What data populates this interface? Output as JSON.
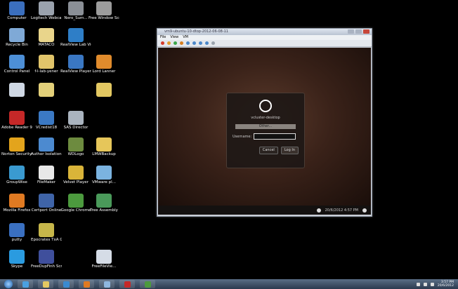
{
  "desktop": {
    "icons": [
      {
        "label": "Computer",
        "color": "#3b6fbe"
      },
      {
        "label": "Logitech Webcam",
        "color": "#9aa2ad"
      },
      {
        "label": "Nero_Sum...",
        "color": "#8a8f96"
      },
      {
        "label": "Free Window Screensaver",
        "color": "#9c9c9c"
      },
      {
        "label": "Recycle Bin",
        "color": "#7fa9d6"
      },
      {
        "label": "MATACO",
        "color": "#e9d58b"
      },
      {
        "label": "RealView Lab Vie...",
        "color": "#2e7ec7"
      },
      {
        "label": "Control Panel",
        "color": "#4d8fd6"
      },
      {
        "label": "f-l-lab-yener",
        "color": "#e1c46a"
      },
      {
        "label": "RealView Player",
        "color": "#3a77c2"
      },
      {
        "label": "Lord Lanner",
        "color": "#e08b2c"
      },
      {
        "label": "",
        "color": "#cfd8e4"
      },
      {
        "label": "",
        "color": "#e3d07a"
      },
      {
        "label": "",
        "color": "#e3c862"
      },
      {
        "label": "Adobe Reader 9",
        "color": "#c52828"
      },
      {
        "label": "VCredist18",
        "color": "#3b79c4"
      },
      {
        "label": "SAS Director",
        "color": "#aab4bf"
      },
      {
        "label": "Norton Security Scan",
        "color": "#e3a41c"
      },
      {
        "label": "Author Isolation...",
        "color": "#4c8ad0"
      },
      {
        "label": "WDLogo",
        "color": "#6d8b3f"
      },
      {
        "label": "LMWBackup",
        "color": "#e6c65a"
      },
      {
        "label": "GroupWise",
        "color": "#3a9ad0"
      },
      {
        "label": "FileMaker",
        "color": "#e8e8e8"
      },
      {
        "label": "Velvet Player",
        "color": "#d9b439"
      },
      {
        "label": "VMware pl...",
        "color": "#7bb3e0"
      },
      {
        "label": "Mozilla Firefox",
        "color": "#e07a22"
      },
      {
        "label": "Certport Online",
        "color": "#3f64a8"
      },
      {
        "label": "Google Chrome",
        "color": "#4c9a3e"
      },
      {
        "label": "Tree Assembly",
        "color": "#4a9a5a"
      },
      {
        "label": "putty",
        "color": "#3a70c1"
      },
      {
        "label": "Epocrates TxA Go...",
        "color": "#c6b64a"
      },
      {
        "label": "Skype",
        "color": "#2a9be0"
      },
      {
        "label": "FreeDupFinh Screenrecorder",
        "color": "#3f4f9c"
      },
      {
        "label": "FreeFileVie...",
        "color": "#d5dce6"
      }
    ]
  },
  "vm_window": {
    "title": "vm9-ubuntu-10-dtop-2012-06-08-11",
    "menu": [
      "File",
      "View",
      "VM"
    ],
    "toolbar_icons": [
      {
        "name": "stop-icon",
        "color": "#d53a2a"
      },
      {
        "name": "pause-icon",
        "color": "#e39a2b"
      },
      {
        "name": "play-icon",
        "color": "#3aa64a"
      },
      {
        "name": "reset-icon",
        "color": "#d67e1f"
      },
      {
        "name": "snapshot-icon",
        "color": "#4a86c8"
      },
      {
        "name": "revert-icon",
        "color": "#4a86c8"
      },
      {
        "name": "manager-icon",
        "color": "#4a86c8"
      },
      {
        "name": "fullscreen-icon",
        "color": "#4a86c8"
      },
      {
        "name": "unity-icon",
        "color": "#9aa2ad"
      }
    ],
    "login": {
      "hostname": "vcluster-desktop",
      "other_label": "Other...",
      "username_label": "Username:",
      "username_value": "",
      "cancel_label": "Cancel",
      "login_label": "Log In"
    },
    "status": {
      "datetime": "20/6/2012 4:57 PM"
    }
  },
  "taskbar": {
    "buttons": [
      {
        "name": "ie-icon",
        "color": "#4aa0e0"
      },
      {
        "name": "explorer-icon",
        "color": "#e3c862"
      },
      {
        "name": "media-player-icon",
        "color": "#3a8ad0"
      },
      {
        "name": "firefox-icon",
        "color": "#e07a22"
      },
      {
        "name": "vmware-icon",
        "color": "#8fb7df"
      },
      {
        "name": "adobe-icon",
        "color": "#c52828"
      },
      {
        "name": "chrome-icon",
        "color": "#4c9a3e"
      }
    ],
    "clock_time": "3:57 PM",
    "clock_date": "20/6/2012"
  }
}
